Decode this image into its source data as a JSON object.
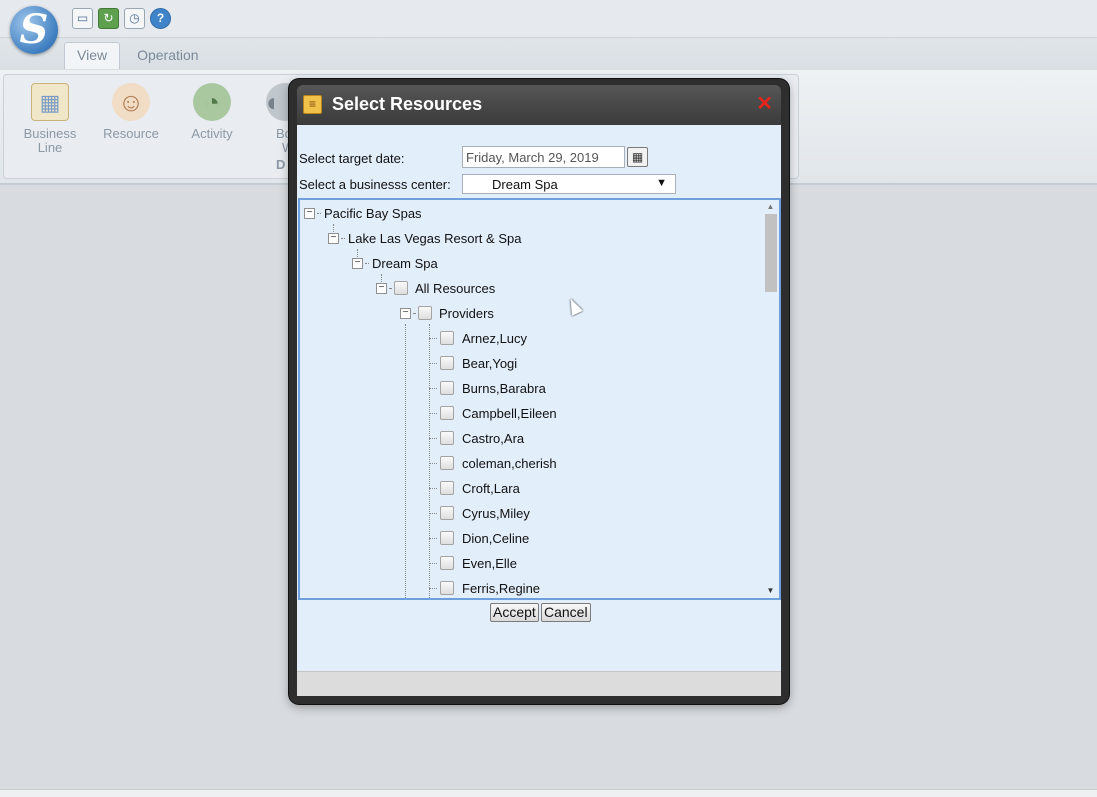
{
  "app": {
    "logo_letter": "S",
    "quick_icons": [
      "window-icon",
      "refresh-icon",
      "clock-icon",
      "help-icon"
    ],
    "tabs": [
      {
        "label": "View",
        "active": true
      },
      {
        "label": "Operation",
        "active": false
      }
    ],
    "ribbon": {
      "buttons": [
        {
          "label_line1": "Business",
          "label_line2": "Line",
          "icon": "business-line-icon"
        },
        {
          "label_line1": "Resource",
          "label_line2": "",
          "icon": "resource-icon"
        },
        {
          "label_line1": "Activity",
          "label_line2": "",
          "icon": "activity-icon"
        },
        {
          "label_line1": "Bo",
          "label_line2": "W",
          "icon": "book-icon"
        }
      ],
      "group_caption": "D"
    }
  },
  "dialog": {
    "title": "Select Resources",
    "close_glyph": "✕",
    "target_date_label": "Select target date:",
    "target_date_value": "Friday, March 29, 2019",
    "business_center_label": "Select a businesss center:",
    "business_center_value": "Dream Spa",
    "tree": {
      "root": "Pacific Bay Spas",
      "resort": "Lake Las Vegas Resort & Spa",
      "center": "Dream Spa",
      "all_resources": "All Resources",
      "providers_label": "Providers",
      "providers": [
        "Arnez,Lucy",
        "Bear,Yogi",
        "Burns,Barabra",
        "Campbell,Eileen",
        "Castro,Ara",
        "coleman,cherish",
        "Croft,Lara",
        "Cyrus,Miley",
        "Dion,Celine",
        "Even,Elle",
        "Ferris,Regine"
      ]
    },
    "accept_label": "Accept",
    "cancel_label": "Cancel"
  },
  "colors": {
    "dialog_frame": "#2e2e2e",
    "dialog_body": "#e3eefb",
    "tree_border": "#6f9fdc",
    "close_red": "#e2261b"
  }
}
